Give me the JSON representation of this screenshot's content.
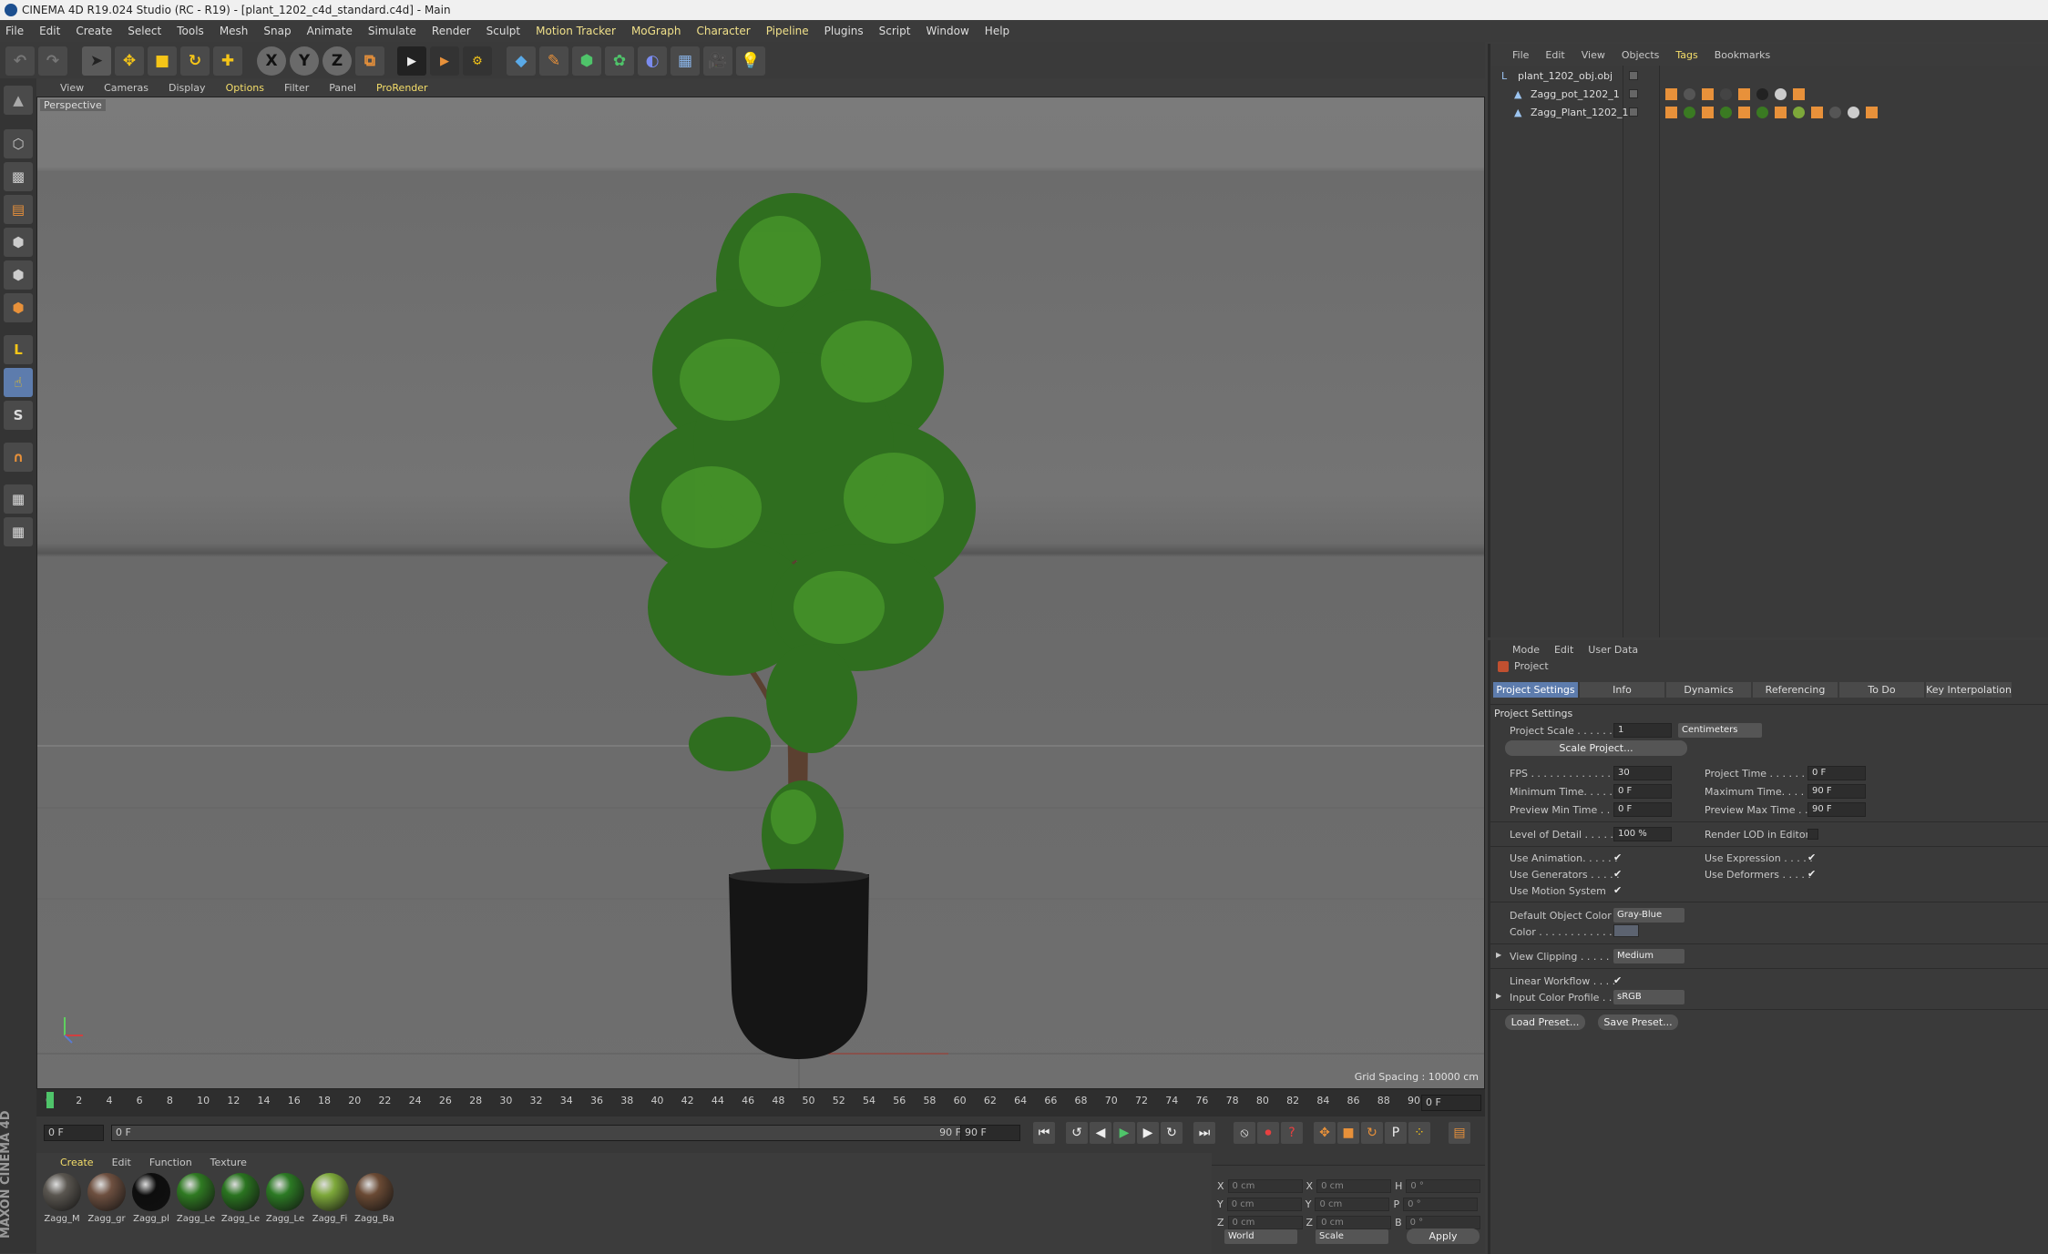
{
  "window": {
    "title": "CINEMA 4D R19.024 Studio (RC - R19) - [plant_1202_c4d_standard.c4d] - Main"
  },
  "menubar": [
    "File",
    "Edit",
    "Create",
    "Select",
    "Tools",
    "Mesh",
    "Snap",
    "Animate",
    "Simulate",
    "Render",
    "Sculpt",
    "Motion Tracker",
    "MoGraph",
    "Character",
    "Pipeline",
    "Plugins",
    "Script",
    "Window",
    "Help"
  ],
  "viewport": {
    "menu": [
      "View",
      "Cameras",
      "Display",
      "Options",
      "Filter",
      "Panel",
      "ProRender"
    ],
    "label": "Perspective",
    "grid_spacing": "Grid Spacing : 10000 cm"
  },
  "timeline": {
    "ticks": [
      "0",
      "2",
      "4",
      "6",
      "8",
      "10",
      "12",
      "14",
      "16",
      "18",
      "20",
      "22",
      "24",
      "26",
      "28",
      "30",
      "32",
      "34",
      "36",
      "38",
      "40",
      "42",
      "44",
      "46",
      "48",
      "50",
      "52",
      "54",
      "56",
      "58",
      "60",
      "62",
      "64",
      "66",
      "68",
      "70",
      "72",
      "74",
      "76",
      "78",
      "80",
      "82",
      "84",
      "86",
      "88",
      "90"
    ],
    "end_field": "0 F",
    "current": "0 F",
    "range_start": "0 F",
    "range_end": "90 F",
    "max": "90 F"
  },
  "materials": {
    "menu": [
      "Create",
      "Edit",
      "Function",
      "Texture"
    ],
    "items": [
      {
        "name": "Zagg_M",
        "color": "#5a5650"
      },
      {
        "name": "Zagg_gr",
        "color": "#6e5040"
      },
      {
        "name": "Zagg_pl",
        "color": "#0d0d0d"
      },
      {
        "name": "Zagg_Le",
        "color": "#2f7a22"
      },
      {
        "name": "Zagg_Le",
        "color": "#2a7420"
      },
      {
        "name": "Zagg_Le",
        "color": "#2c7a24"
      },
      {
        "name": "Zagg_Fi",
        "color": "#7da83a"
      },
      {
        "name": "Zagg_Ba",
        "color": "#6a4a34"
      }
    ]
  },
  "coords": {
    "rows": [
      {
        "a": "X",
        "av": "0 cm",
        "b": "X",
        "bv": "0 cm",
        "c": "H",
        "cv": "0 °"
      },
      {
        "a": "Y",
        "av": "0 cm",
        "b": "Y",
        "bv": "0 cm",
        "c": "P",
        "cv": "0 °"
      },
      {
        "a": "Z",
        "av": "0 cm",
        "b": "Z",
        "bv": "0 cm",
        "c": "B",
        "cv": "0 °"
      }
    ],
    "world": "World",
    "scale": "Scale",
    "apply": "Apply"
  },
  "object_manager": {
    "menu": [
      "File",
      "Edit",
      "View",
      "Objects",
      "Tags",
      "Bookmarks"
    ],
    "objects": [
      "plant_1202_obj.obj",
      "Zagg_pot_1202_1",
      "Zagg_Plant_1202_1"
    ]
  },
  "attributes": {
    "menu": [
      "Mode",
      "Edit",
      "User Data"
    ],
    "object": "Project",
    "tabs": [
      "Project Settings",
      "Info",
      "Dynamics",
      "Referencing",
      "To Do",
      "Key Interpolation"
    ],
    "section": "Project Settings",
    "project_scale_label": "Project Scale . . . . . .",
    "project_scale_value": "1",
    "project_scale_unit": "Centimeters",
    "scale_project_btn": "Scale Project...",
    "fps_label": "FPS . . . . . . . . . . . . . . .",
    "fps": "30",
    "project_time_label": "Project Time . . . . . . . .",
    "project_time": "0 F",
    "min_time_label": "Minimum Time. . . . . . .",
    "min_time": "0 F",
    "max_time_label": "Maximum Time. . . . . . .",
    "max_time": "90 F",
    "prev_min_label": "Preview Min Time . . .",
    "prev_min": "0 F",
    "prev_max_label": "Preview Max Time . . .",
    "prev_max": "90 F",
    "lod_label": "Level of Detail . . . . . .",
    "lod": "100 %",
    "render_lod_label": "Render LOD in Editor",
    "use_animation": "Use Animation. . . . . .",
    "use_expression": "Use Expression . . . . .",
    "use_generators": "Use Generators . . . . .",
    "use_deformers": "Use Deformers . . . . .",
    "use_motion": "Use Motion System",
    "default_color_label": "Default Object Color",
    "default_color": "Gray-Blue",
    "color_label": "Color . . . . . . . . . . . .",
    "view_clipping_label": "View Clipping . . . . . .",
    "view_clipping": "Medium",
    "linear_workflow": "Linear Workflow . . . .",
    "input_color_label": "Input Color Profile . . .",
    "input_color": "sRGB",
    "load_preset": "Load Preset...",
    "save_preset": "Save Preset...",
    "check": "✔"
  },
  "colors": {
    "accent": "#5d7cad",
    "menu_highlight": "#f0e08a",
    "panel": "#3a3a3a",
    "viewport": "#757575"
  },
  "brand": "MAXON CINEMA 4D"
}
